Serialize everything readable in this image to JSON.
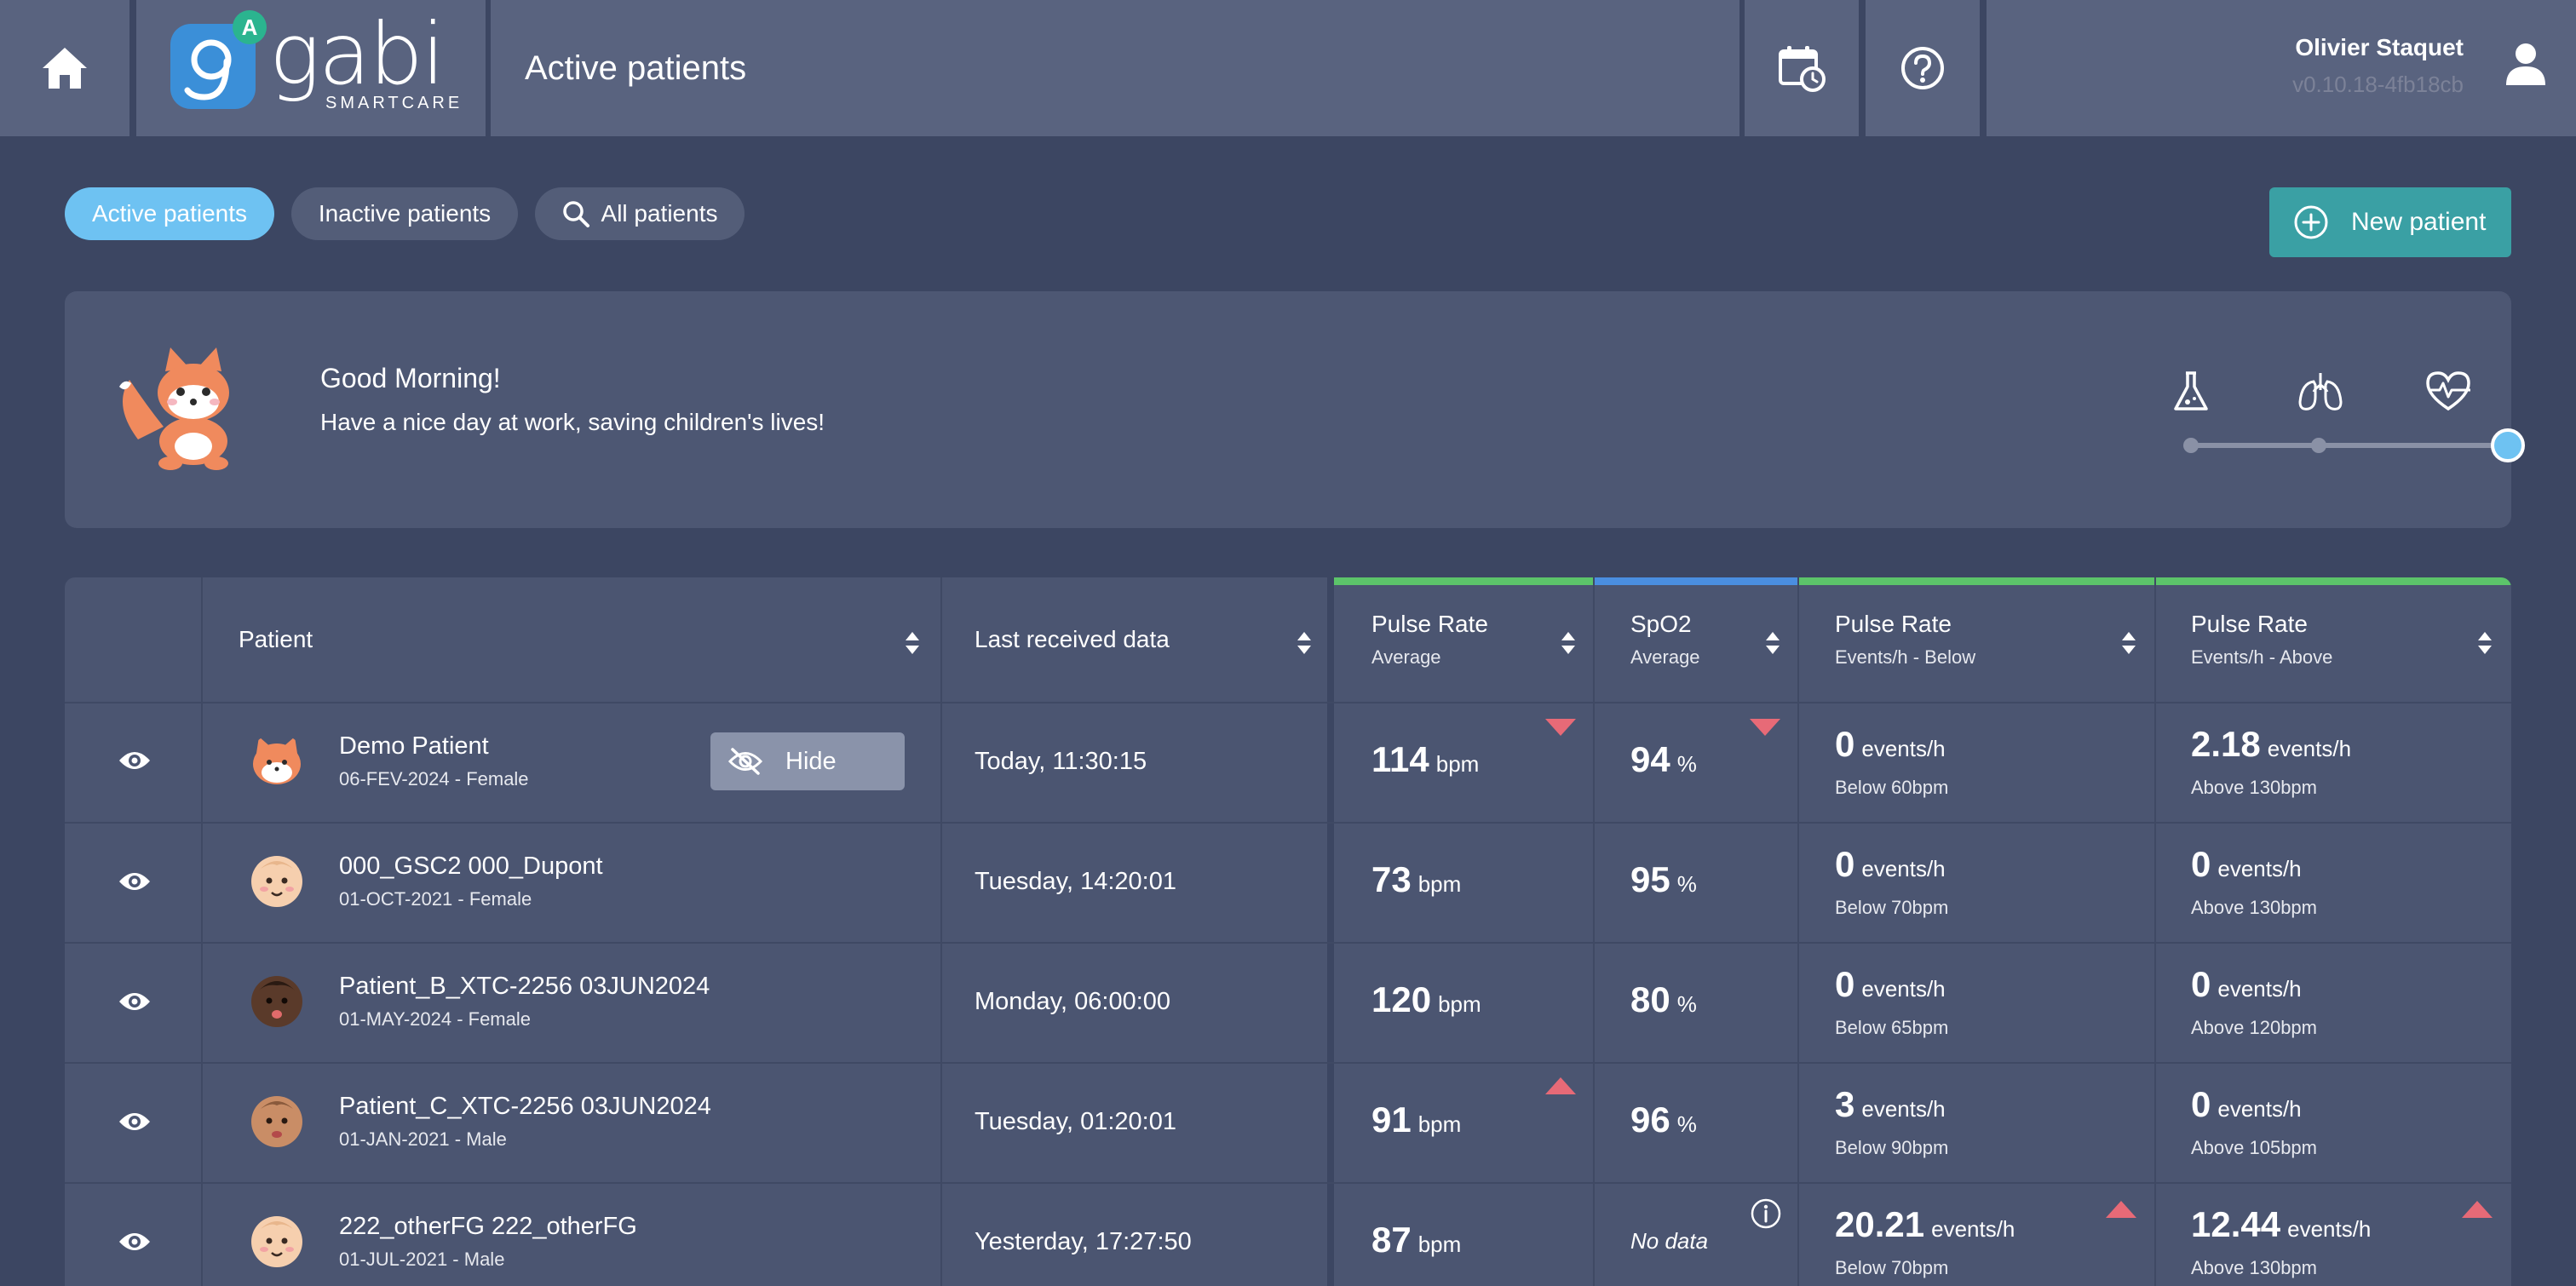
{
  "header": {
    "title": "Active patients",
    "logo_text": "gabi",
    "logo_sub": "SMARTCARE",
    "logo_badge": "A",
    "user_name": "Olivier Staquet",
    "version": "v0.10.18-4fb18cb"
  },
  "filters": {
    "active": "Active patients",
    "inactive": "Inactive patients",
    "all": "All patients",
    "new_patient": "New patient"
  },
  "greeting": {
    "title": "Good Morning!",
    "subtitle": "Have a nice day at work, saving children's lives!",
    "mode_icons": [
      "flask-icon",
      "lungs-icon",
      "heart-pulse-icon"
    ],
    "mode_selected": 2
  },
  "colors": {
    "accent": "#6ec2f2",
    "new_button": "#3aa0a4",
    "pulse_group": "#5cc46a",
    "spo2_group": "#4a8ee0",
    "alert": "#e76a77"
  },
  "table": {
    "columns": {
      "patient": "Patient",
      "last": "Last received data",
      "pr_avg": {
        "label": "Pulse Rate",
        "sub": "Average"
      },
      "spo2_avg": {
        "label": "SpO2",
        "sub": "Average"
      },
      "pr_below": {
        "label": "Pulse Rate",
        "sub": "Events/h - Below"
      },
      "pr_above": {
        "label": "Pulse Rate",
        "sub": "Events/h - Above"
      }
    },
    "hide_label": "Hide",
    "no_data": "No data",
    "rows": [
      {
        "name": "Demo Patient",
        "info": "06-FEV-2024 - Female",
        "last": "Today, 11:30:15",
        "pr": "114",
        "pr_unit": "bpm",
        "spo2": "94",
        "spo2_unit": "%",
        "below": "0",
        "below_unit": "events/h",
        "below_sub": "Below 60bpm",
        "above": "2.18",
        "above_unit": "events/h",
        "above_sub": "Above 130bpm"
      },
      {
        "name": "000_GSC2 000_Dupont",
        "info": "01-OCT-2021 - Female",
        "last": "Tuesday, 14:20:01",
        "pr": "73",
        "pr_unit": "bpm",
        "spo2": "95",
        "spo2_unit": "%",
        "below": "0",
        "below_unit": "events/h",
        "below_sub": "Below 70bpm",
        "above": "0",
        "above_unit": "events/h",
        "above_sub": "Above 130bpm"
      },
      {
        "name": "Patient_B_XTC-2256 03JUN2024",
        "info": "01-MAY-2024 - Female",
        "last": "Monday, 06:00:00",
        "pr": "120",
        "pr_unit": "bpm",
        "spo2": "80",
        "spo2_unit": "%",
        "below": "0",
        "below_unit": "events/h",
        "below_sub": "Below 65bpm",
        "above": "0",
        "above_unit": "events/h",
        "above_sub": "Above 120bpm"
      },
      {
        "name": "Patient_C_XTC-2256 03JUN2024",
        "info": "01-JAN-2021 - Male",
        "last": "Tuesday, 01:20:01",
        "pr": "91",
        "pr_unit": "bpm",
        "spo2": "96",
        "spo2_unit": "%",
        "below": "3",
        "below_unit": "events/h",
        "below_sub": "Below 90bpm",
        "above": "0",
        "above_unit": "events/h",
        "above_sub": "Above 105bpm"
      },
      {
        "name": "222_otherFG 222_otherFG",
        "info": "01-JUL-2021 - Male",
        "last": "Yesterday, 17:27:50",
        "pr": "87",
        "pr_unit": "bpm",
        "spo2": "No data",
        "spo2_unit": "",
        "below": "20.21",
        "below_unit": "events/h",
        "below_sub": "Below 70bpm",
        "above": "12.44",
        "above_unit": "events/h",
        "above_sub": "Above 130bpm"
      }
    ]
  }
}
